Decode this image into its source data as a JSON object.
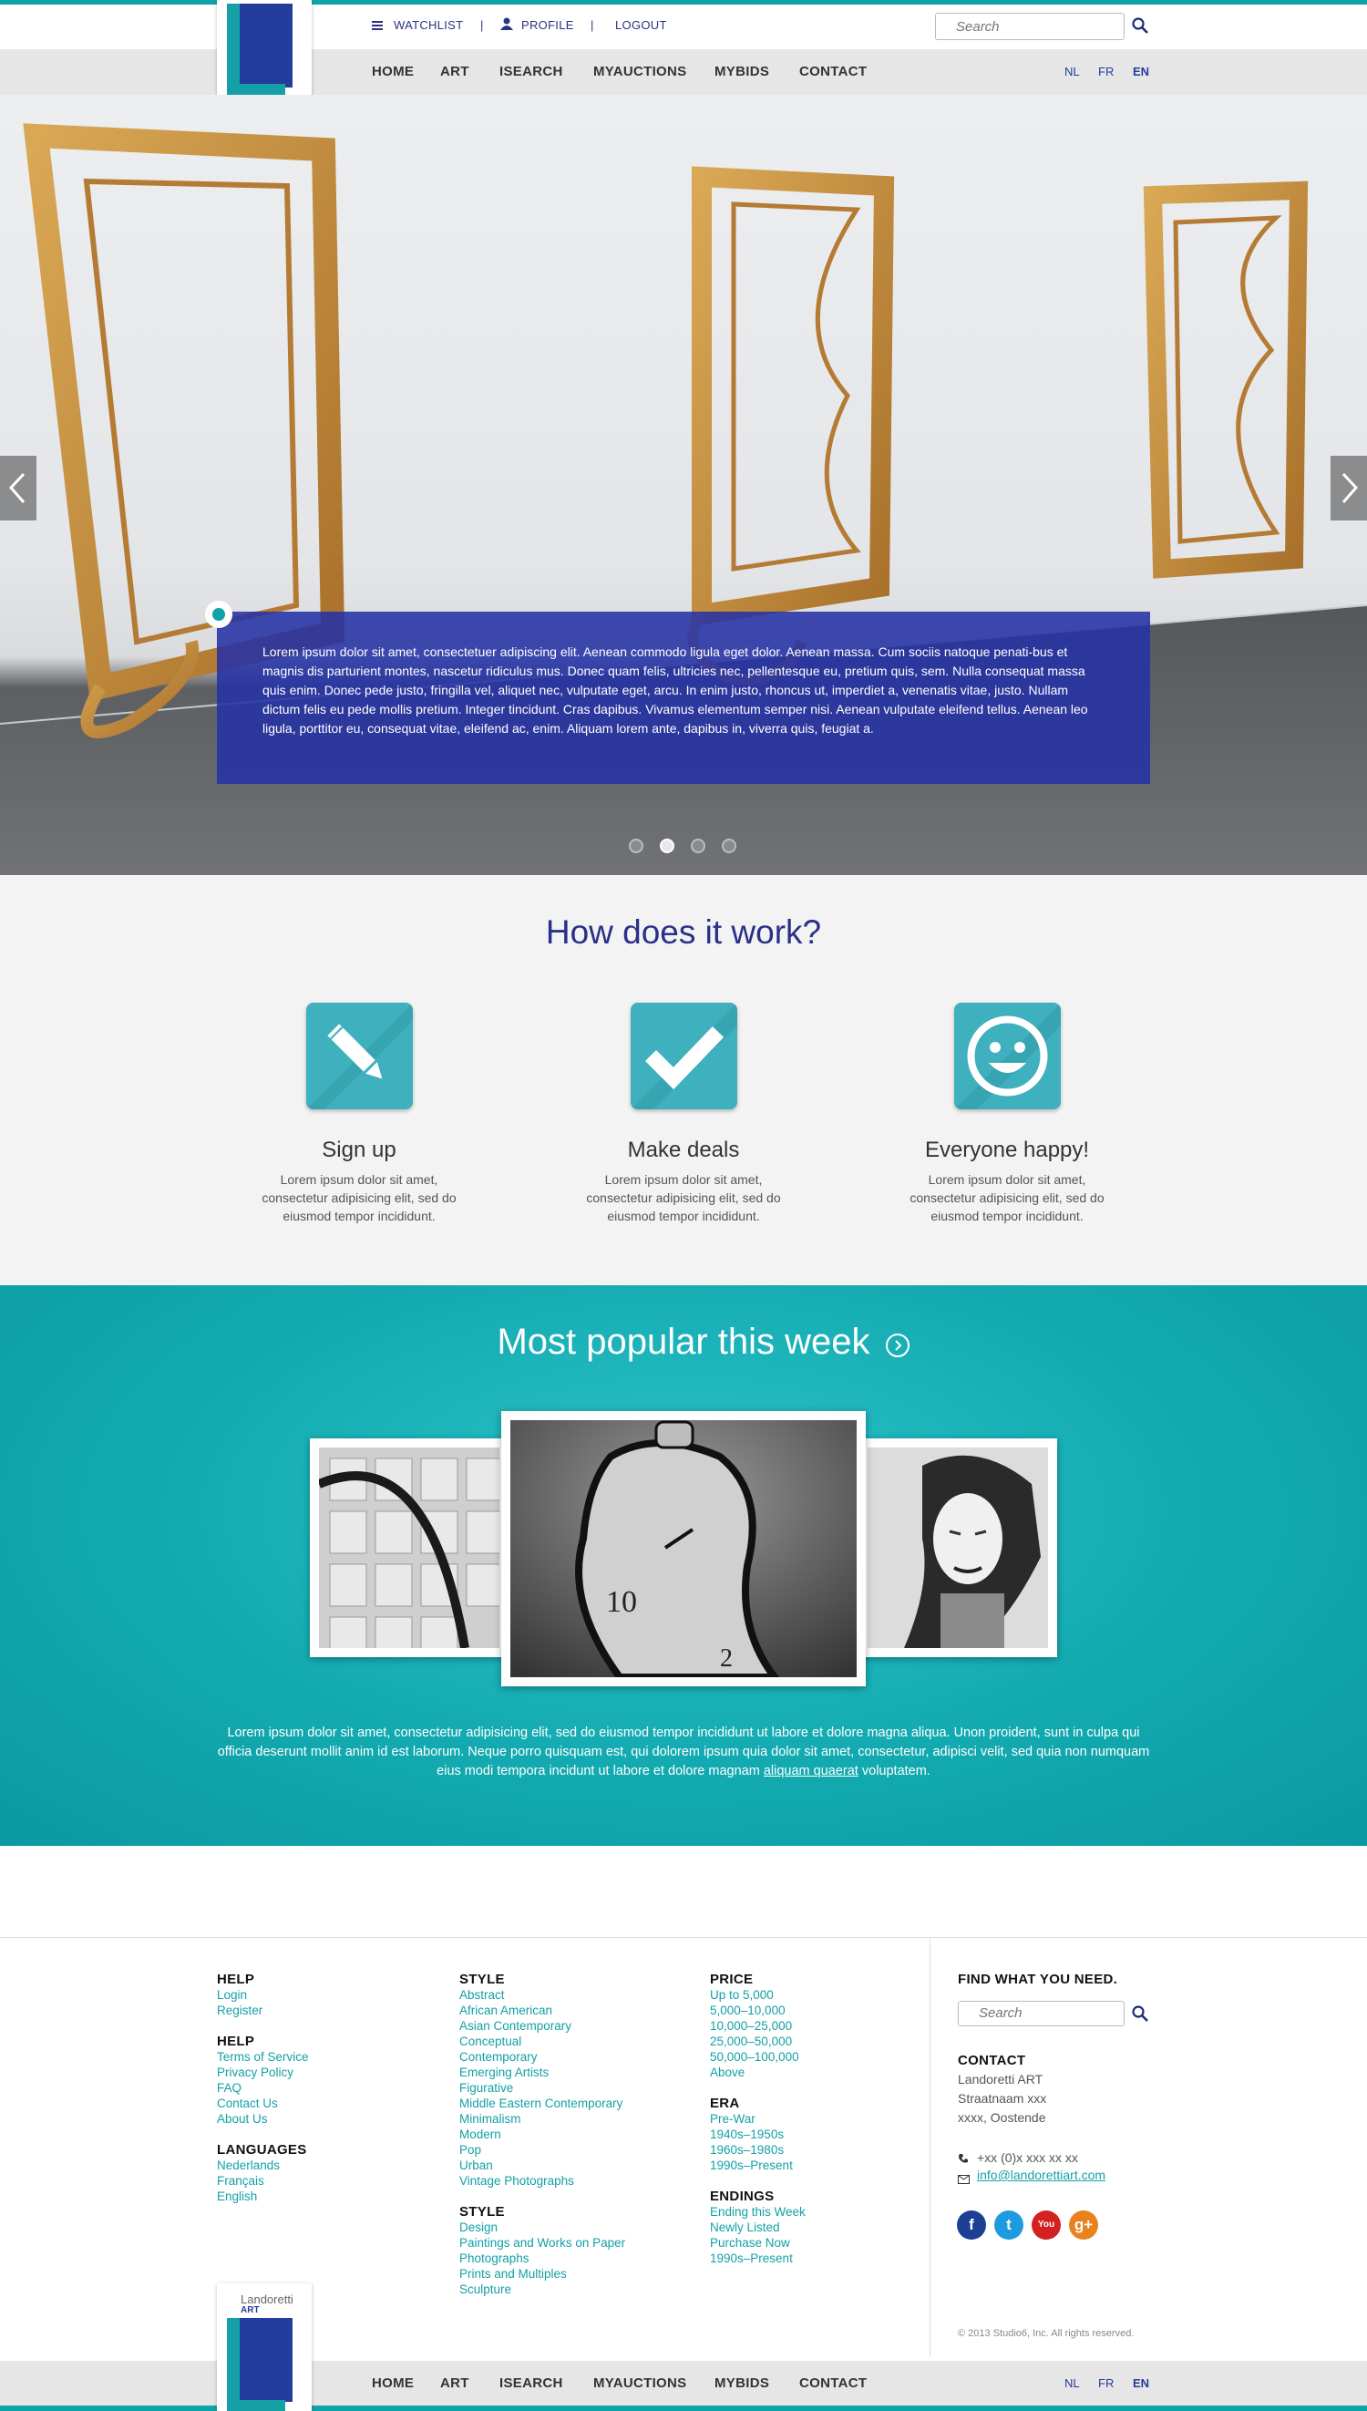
{
  "brand": {
    "name": "Landoretti",
    "sub": "ART"
  },
  "util": {
    "watchlist": "WATCHLIST",
    "profile": "PROFILE",
    "logout": "LOGOUT",
    "sep": "|",
    "search_placeholder": "Search"
  },
  "nav": {
    "items": [
      "HOME",
      "ART",
      "ISEARCH",
      "MYAUCTIONS",
      "MYBIDS",
      "CONTACT"
    ],
    "langs": [
      "NL",
      "FR",
      "EN"
    ],
    "active_lang": "EN"
  },
  "hero": {
    "caption": "Lorem ipsum dolor sit amet, consectetuer adipiscing elit. Aenean commodo ligula eget dolor. Aenean massa. Cum sociis natoque penati-bus et magnis dis parturient montes, nascetur ridiculus mus. Donec quam felis, ultricies nec, pellentesque eu, pretium quis, sem. Nulla consequat massa quis enim. Donec pede justo, fringilla vel, aliquet nec, vulputate eget, arcu. In enim justo, rhoncus ut, imperdiet a, venenatis vitae, justo. Nullam dictum felis eu pede mollis pretium. Integer tincidunt. Cras dapibus. Vivamus elementum semper nisi. Aenean vulputate eleifend tellus. Aenean leo ligula, porttitor eu, consequat vitae, eleifend ac, enim. Aliquam lorem ante, dapibus in, viverra quis, feugiat a.",
    "slides": 4,
    "active_slide": 2
  },
  "how": {
    "title": "How does it work?",
    "features": [
      {
        "title": "Sign up",
        "text": "Lorem ipsum dolor sit amet, consectetur adipisicing elit, sed do eiusmod tempor incididunt.",
        "icon": "pencil-icon"
      },
      {
        "title": "Make deals",
        "text": "Lorem ipsum dolor sit amet, consectetur adipisicing elit, sed do eiusmod tempor incididunt.",
        "icon": "checkmark-icon"
      },
      {
        "title": "Everyone happy!",
        "text": "Lorem ipsum dolor sit amet, consectetur adipisicing elit, sed do eiusmod tempor incididunt.",
        "icon": "smiley-icon"
      }
    ]
  },
  "popular": {
    "title": "Most popular this week",
    "text_before": "Lorem ipsum dolor sit amet, consectetur adipisicing elit, sed do eiusmod tempor incididunt ut labore et dolore magna aliqua. Unon proident, sunt in culpa qui officia deserunt mollit anim id est laborum. Neque porro quisquam est, qui dolorem ipsum quia dolor sit amet, consectetur, adipisci velit, sed quia non numquam eius modi tempora incidunt ut labore et dolore magnam",
    "link": "aliquam quaerat",
    "text_after": "voluptatem."
  },
  "footer": {
    "col1": [
      {
        "heading": "HELP",
        "links": [
          "Login",
          "Register"
        ]
      },
      {
        "heading": "HELP",
        "links": [
          "Terms of Service",
          "Privacy Policy",
          "FAQ",
          "Contact Us",
          "About Us"
        ]
      },
      {
        "heading": "LANGUAGES",
        "links": [
          "Nederlands",
          "Français",
          "English"
        ]
      }
    ],
    "col2": [
      {
        "heading": "STYLE",
        "links": [
          "Abstract",
          "African American",
          "Asian Contemporary",
          "Conceptual",
          "Contemporary",
          "Emerging Artists",
          "Figurative",
          "Middle Eastern Contemporary",
          "Minimalism",
          "Modern",
          "Pop",
          "Urban",
          "Vintage Photographs"
        ]
      },
      {
        "heading": "STYLE",
        "links": [
          "Design",
          "Paintings and Works on Paper",
          "Photographs",
          "Prints and Multiples",
          "Sculpture"
        ]
      }
    ],
    "col3": [
      {
        "heading": "PRICE",
        "links": [
          "Up to 5,000",
          "5,000–10,000",
          "10,000–25,000",
          "25,000–50,000",
          "50,000–100,000",
          "Above"
        ]
      },
      {
        "heading": "ERA",
        "links": [
          "Pre-War",
          "1940s–1950s",
          "1960s–1980s",
          "1990s–Present"
        ]
      },
      {
        "heading": "ENDINGS",
        "links": [
          "Ending this Week",
          "Newly Listed",
          "Purchase Now",
          "1990s–Present"
        ]
      }
    ],
    "find_heading": "FIND WHAT YOU NEED.",
    "search_placeholder": "Search",
    "contact_heading": "CONTACT",
    "address": [
      "Landoretti ART",
      "Straatnaam xxx",
      "xxxx, Oostende"
    ],
    "phone": "+xx (0)x xxx xx xx",
    "email": "info@landorettiart.com",
    "social": [
      {
        "name": "facebook-icon",
        "glyph": "f",
        "color": "#1c3f94"
      },
      {
        "name": "twitter-icon",
        "glyph": "t",
        "color": "#1e9be0"
      },
      {
        "name": "youtube-icon",
        "glyph": "You",
        "color": "#d42020"
      },
      {
        "name": "google-plus-icon",
        "glyph": "g+",
        "color": "#e8821e"
      }
    ],
    "copyright": "© 2013 Studio6, Inc. All rights reserved."
  }
}
